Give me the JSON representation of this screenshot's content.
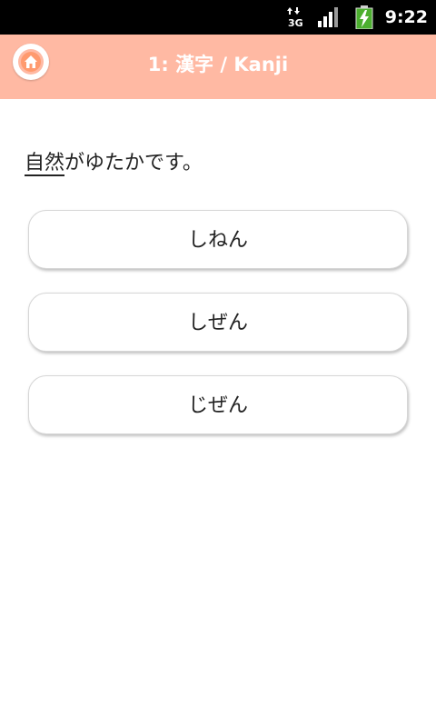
{
  "status_bar": {
    "network_label": "3G",
    "time": "9:22",
    "icons": [
      "network-3g-icon",
      "signal-icon",
      "battery-charging-icon"
    ]
  },
  "header": {
    "title": "1: 漢字 / Kanji",
    "home_icon": "home-icon",
    "background_color": "#ffb9a3"
  },
  "question": {
    "target_word": "自然",
    "rest": "がゆたかです。"
  },
  "answers": [
    {
      "label": "しねん"
    },
    {
      "label": "しぜん"
    },
    {
      "label": "じぜん"
    }
  ]
}
